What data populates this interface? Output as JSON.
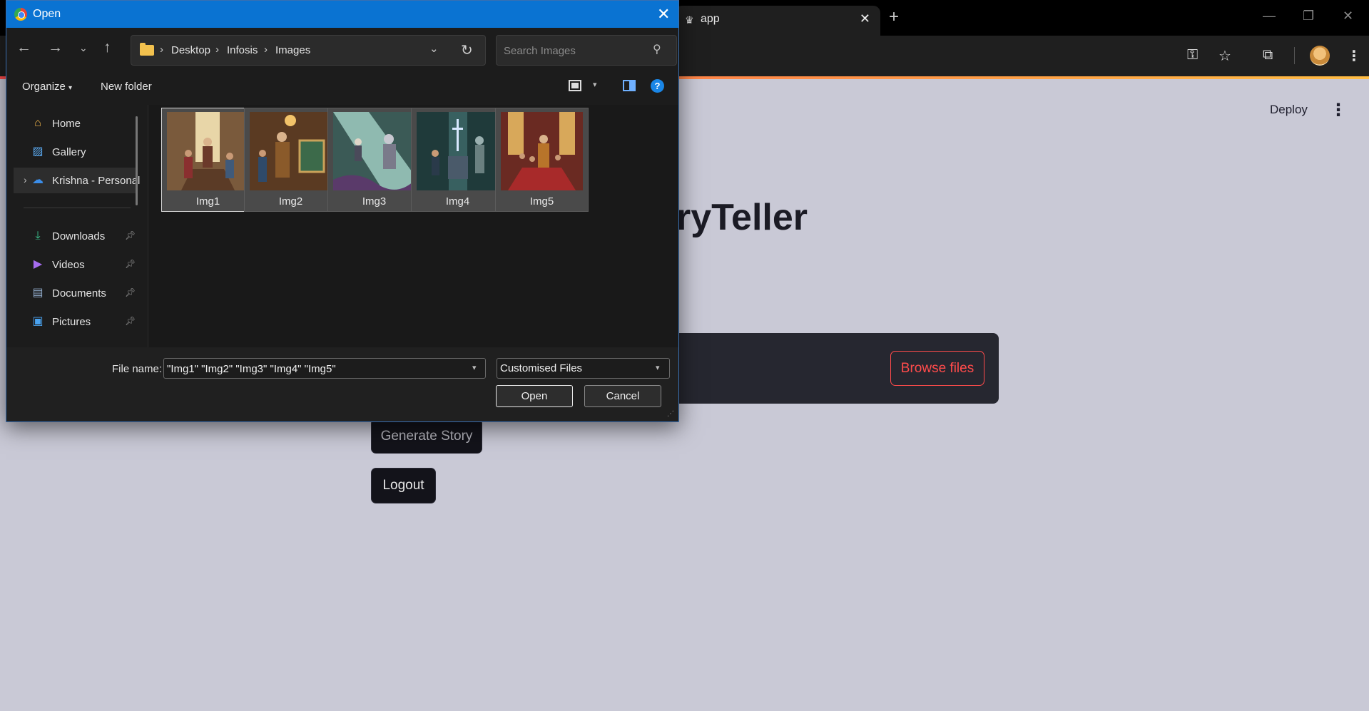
{
  "browser": {
    "tab": {
      "title": "app",
      "favicon_icon": "crown-icon",
      "close_glyph": "✕"
    },
    "new_tab_glyph": "+",
    "window_controls": [
      "minimize-icon",
      "restore-icon",
      "close-icon"
    ],
    "toolbar_icons": [
      "password-key-icon",
      "bookmark-star-icon",
      "extensions-icon",
      "profile-avatar",
      "more-vert-icon"
    ],
    "accent_gradient": [
      "#ff4b4b",
      "#ffbd45"
    ]
  },
  "page": {
    "deploy_label": "Deploy",
    "title_visible_part": "ryTeller",
    "browse_button_label": "Browse files",
    "generate_button_label": "Generate Story",
    "logout_button_label": "Logout",
    "accent_color": "#ff4b4b"
  },
  "dialog": {
    "title": "Open",
    "breadcrumb": [
      "Desktop",
      "Infosis",
      "Images"
    ],
    "search_placeholder": "Search Images",
    "organize_label": "Organize",
    "new_folder_label": "New folder",
    "help_glyph": "?",
    "nav_items": [
      {
        "label": "Home",
        "icon": "home-icon",
        "pinned": false
      },
      {
        "label": "Gallery",
        "icon": "gallery-icon",
        "pinned": false
      },
      {
        "label": "Krishna - Personal",
        "icon": "onedrive-cloud-icon",
        "pinned": false,
        "selected": true
      },
      {
        "label": "Downloads",
        "icon": "download-icon",
        "pinned": true
      },
      {
        "label": "Videos",
        "icon": "videos-icon",
        "pinned": true
      },
      {
        "label": "Documents",
        "icon": "documents-icon",
        "pinned": true
      },
      {
        "label": "Pictures",
        "icon": "pictures-icon",
        "pinned": true
      }
    ],
    "files": [
      {
        "name": "Img1"
      },
      {
        "name": "Img2"
      },
      {
        "name": "Img3"
      },
      {
        "name": "Img4"
      },
      {
        "name": "Img5"
      }
    ],
    "filename_label": "File name:",
    "filename_value": "\"Img1\" \"Img2\" \"Img3\" \"Img4\" \"Img5\"",
    "filetype_label": "Customised Files",
    "open_button_label": "Open",
    "cancel_button_label": "Cancel",
    "titlebar_color": "#0a73d2"
  }
}
